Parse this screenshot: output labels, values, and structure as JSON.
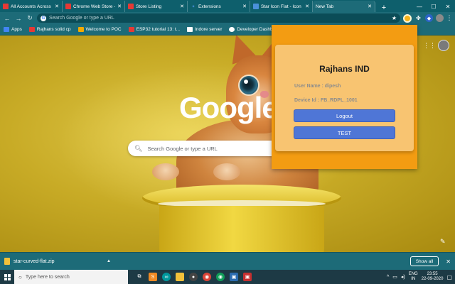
{
  "tabs": [
    {
      "label": "All Accounts Across",
      "favicon_color": "#e53935",
      "active": false
    },
    {
      "label": "Chrome Web Store -",
      "favicon_color": "#e53935",
      "active": false
    },
    {
      "label": "Store Listing",
      "favicon_color": "#e53935",
      "active": false
    },
    {
      "label": "Extensions",
      "favicon_color": "#4a90d9",
      "active": false
    },
    {
      "label": "Star Icon Flat - Icon",
      "favicon_color": "#4a90d9",
      "active": false
    },
    {
      "label": "New Tab",
      "favicon_color": "",
      "active": true
    }
  ],
  "toolbar": {
    "omnibox_placeholder": "Search Google or type a URL"
  },
  "bookmarks": [
    {
      "label": "Apps",
      "color": "#4285f4"
    },
    {
      "label": "Rajhans solid cp",
      "color": "#e53935"
    },
    {
      "label": "Welcome to POC",
      "color": "#f2a900"
    },
    {
      "label": "ESP32 tutorial 13: t...",
      "color": "#e53935"
    },
    {
      "label": "Indore server",
      "color": "#ffffff"
    },
    {
      "label": "Developer Dashboa...",
      "color": "#ffffff"
    }
  ],
  "ntp": {
    "logo_text": "Google",
    "search_placeholder": "Search Google or type a URL"
  },
  "popup": {
    "title": "Rajhans IND",
    "user_line": "User Name : dipesh",
    "device_line": "Device Id : FB_RDPL_1001",
    "logout_label": "Logout",
    "test_label": "TEST",
    "colors": {
      "background": "#f39c12",
      "card": "#f8c471",
      "button": "#4f76d6"
    }
  },
  "downloads": {
    "file_name": "star-curved-flat.zip",
    "show_all_label": "Show all"
  },
  "taskbar": {
    "search_placeholder": "Type here to search",
    "language_top": "ENG",
    "language_bottom": "IN",
    "time": "23:55",
    "date": "22-09-2020"
  }
}
